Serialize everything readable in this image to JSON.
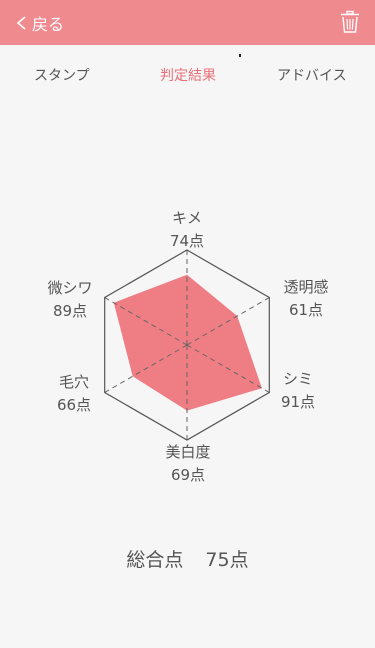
{
  "header": {
    "back_label": "戻る",
    "icons": {
      "back": "chevron-left-icon",
      "delete": "trash-icon"
    },
    "color": "#ef8a8f"
  },
  "tabs": [
    {
      "label": "スタンプ",
      "active": false
    },
    {
      "label": "判定結果",
      "active": true
    },
    {
      "label": "アドバイス",
      "active": false
    }
  ],
  "radar": {
    "fill_color": "#ee7d84",
    "axes": [
      {
        "name": "キメ",
        "score": "74点",
        "value": 74
      },
      {
        "name": "透明感",
        "score": "61点",
        "value": 61
      },
      {
        "name": "シミ",
        "score": "91点",
        "value": 91
      },
      {
        "name": "美白度",
        "score": "69点",
        "value": 69
      },
      {
        "name": "毛穴",
        "score": "66点",
        "value": 66
      },
      {
        "name": "微シワ",
        "score": "89点",
        "value": 89
      }
    ]
  },
  "total": {
    "label": "総合点",
    "value": "75点"
  }
}
